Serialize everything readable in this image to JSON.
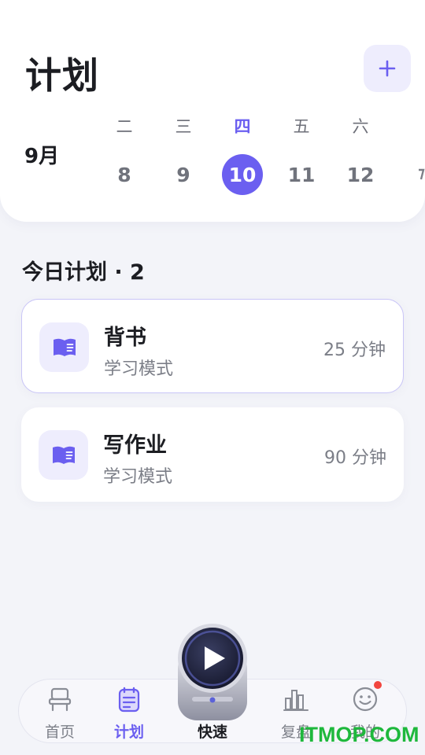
{
  "header": {
    "title": "计划",
    "month": "9月"
  },
  "calendar": {
    "days": [
      {
        "weekday": "二",
        "date": "8"
      },
      {
        "weekday": "三",
        "date": "9"
      },
      {
        "weekday": "四",
        "date": "10"
      },
      {
        "weekday": "五",
        "date": "11"
      },
      {
        "weekday": "六",
        "date": "12"
      }
    ],
    "selected_index": 2
  },
  "today": {
    "title": "今日计划 · 2",
    "plans": [
      {
        "name": "背书",
        "mode": "学习模式",
        "duration": "25 分钟",
        "icon": "book-icon"
      },
      {
        "name": "写作业",
        "mode": "学习模式",
        "duration": "90 分钟",
        "icon": "book-icon"
      }
    ]
  },
  "tabs": [
    {
      "label": "首页",
      "icon": "home-chair-icon"
    },
    {
      "label": "计划",
      "icon": "clipboard-icon"
    },
    {
      "label": "快速",
      "icon": "play-device-icon"
    },
    {
      "label": "复盘",
      "icon": "bar-chart-icon"
    },
    {
      "label": "我的",
      "icon": "smiley-icon"
    }
  ],
  "watermark": "ITMOP.COM",
  "colors": {
    "accent": "#6b5ff0",
    "accent_light": "#eeedfd",
    "badge": "#f2463f",
    "watermark": "#1eb83c"
  }
}
